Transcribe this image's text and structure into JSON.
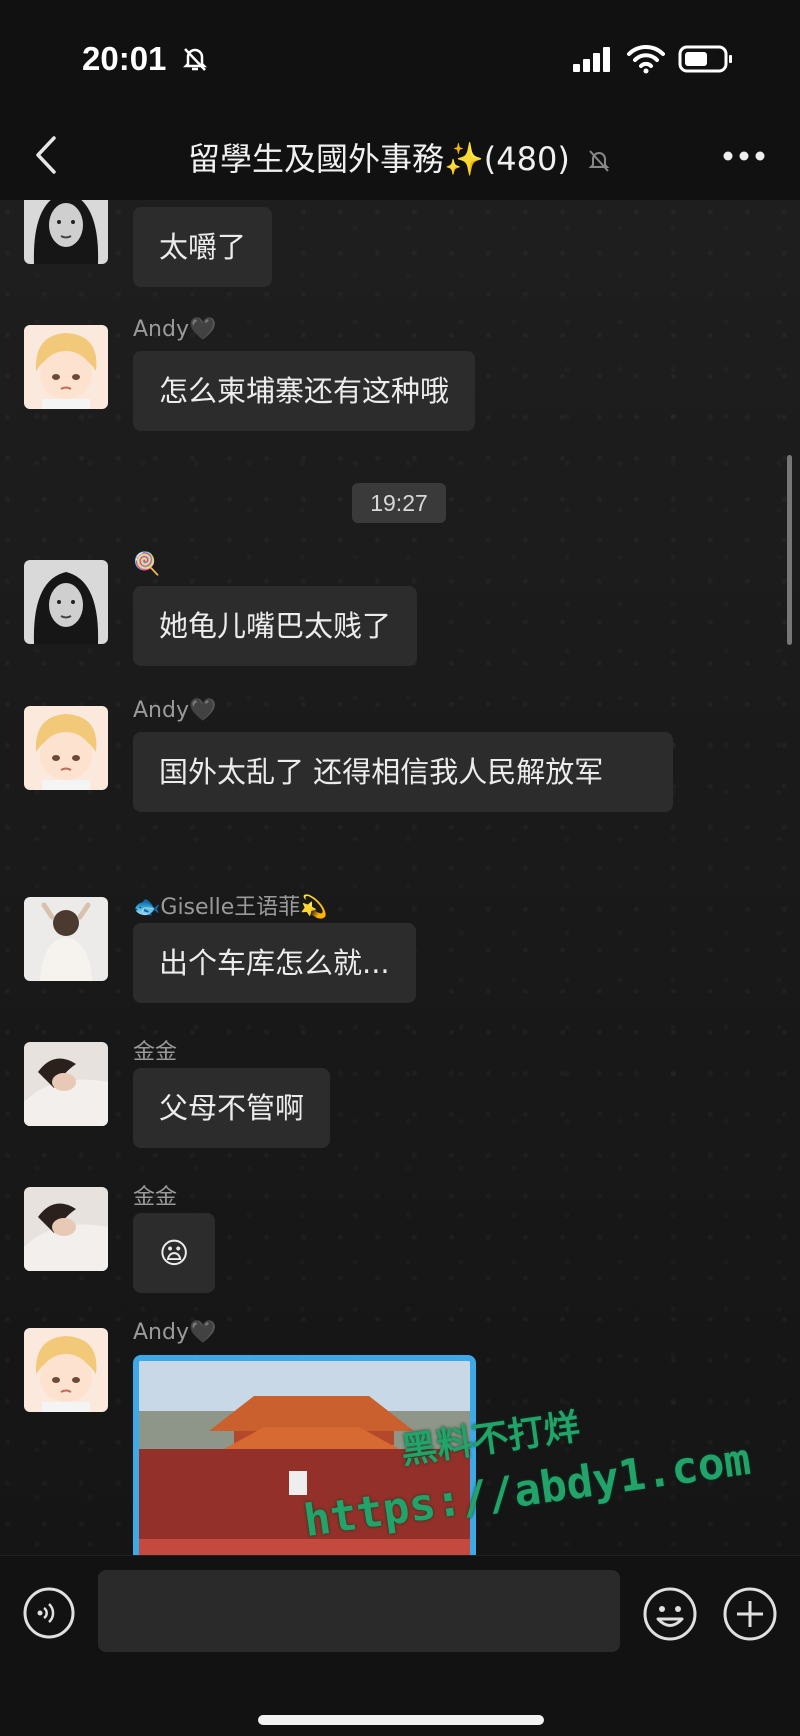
{
  "status_bar": {
    "time": "20:01",
    "icons": [
      "bell-slash-icon",
      "signal-icon",
      "wifi-icon",
      "battery-icon"
    ]
  },
  "header": {
    "title": "留學生及國外事務✨(480)",
    "back_icon": "chevron-left-icon",
    "mute_icon": "bell-slash-icon",
    "more_icon": "more-dots-icon"
  },
  "timestamp": "19:27",
  "messages": [
    {
      "sender": "",
      "text": "太嚼了",
      "avatar": "avatar-woman-bw"
    },
    {
      "sender": "Andy🖤",
      "text": "怎么柬埔寨还有这种哦",
      "avatar": "avatar-cartoon-boy"
    },
    {
      "sender": "🍭",
      "text": "她龟儿嘴巴太贱了",
      "avatar": "avatar-woman-bw"
    },
    {
      "sender": "Andy🖤",
      "text": "国外太乱了 还得相信我人民解放军",
      "avatar": "avatar-cartoon-boy"
    },
    {
      "sender": "🐟Giselle王语菲💫",
      "text": "出个车库怎么就...",
      "avatar": "avatar-woman-back"
    },
    {
      "sender": "金金",
      "text": "父母不管啊",
      "avatar": "avatar-woman-lying"
    },
    {
      "sender": "金金",
      "text": "😦",
      "avatar": "avatar-woman-lying"
    },
    {
      "sender": "Andy🖤",
      "text": "",
      "avatar": "avatar-cartoon-boy",
      "image": "tiananmen-photo"
    }
  ],
  "watermark": {
    "line1": "黑料不打烊",
    "line2": "https://abdy1.com"
  },
  "input_bar": {
    "placeholder": "",
    "voice_icon": "voice-icon",
    "emoji_icon": "emoji-icon",
    "plus_icon": "plus-icon"
  },
  "colors": {
    "background": "#1b1b1b",
    "bubble": "#2c2c2c",
    "watermark": "#22a36a",
    "image_border": "#3da9e6"
  }
}
